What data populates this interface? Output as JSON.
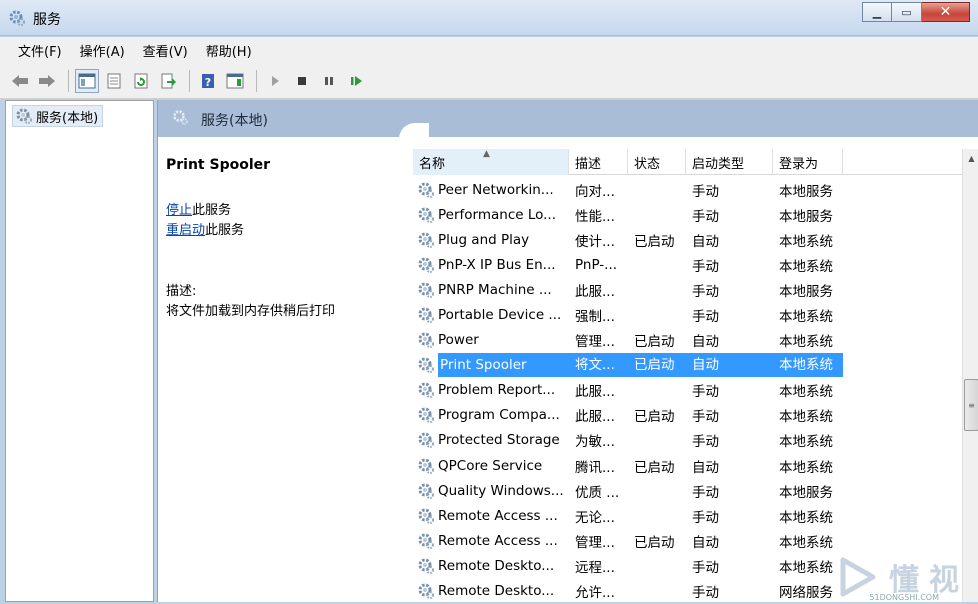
{
  "window": {
    "title": "服务"
  },
  "menu": [
    "文件(F)",
    "操作(A)",
    "查看(V)",
    "帮助(H)"
  ],
  "tree": {
    "root_label": "服务(本地)"
  },
  "main": {
    "header_title": "服务(本地)",
    "selected_service": "Print Spooler",
    "action_stop_link": "停止",
    "action_stop_suffix": "此服务",
    "action_restart_link": "重启动",
    "action_restart_suffix": "此服务",
    "desc_label": "描述:",
    "desc_text": "将文件加载到内存供稍后打印"
  },
  "columns": [
    "名称",
    "描述",
    "状态",
    "启动类型",
    "登录为"
  ],
  "services": [
    {
      "name": "Peer Networkin...",
      "desc": "向对...",
      "status": "",
      "startup": "手动",
      "logon": "本地服务"
    },
    {
      "name": "Performance Lo...",
      "desc": "性能...",
      "status": "",
      "startup": "手动",
      "logon": "本地服务"
    },
    {
      "name": "Plug and Play",
      "desc": "使计...",
      "status": "已启动",
      "startup": "自动",
      "logon": "本地系统"
    },
    {
      "name": "PnP-X IP Bus En...",
      "desc": "PnP-...",
      "status": "",
      "startup": "手动",
      "logon": "本地系统"
    },
    {
      "name": "PNRP Machine ...",
      "desc": "此服...",
      "status": "",
      "startup": "手动",
      "logon": "本地服务"
    },
    {
      "name": "Portable Device ...",
      "desc": "强制...",
      "status": "",
      "startup": "手动",
      "logon": "本地系统"
    },
    {
      "name": "Power",
      "desc": "管理...",
      "status": "已启动",
      "startup": "自动",
      "logon": "本地系统"
    },
    {
      "name": "Print Spooler",
      "desc": "将文...",
      "status": "已启动",
      "startup": "自动",
      "logon": "本地系统"
    },
    {
      "name": "Problem Report...",
      "desc": "此服...",
      "status": "",
      "startup": "手动",
      "logon": "本地系统"
    },
    {
      "name": "Program Compa...",
      "desc": "此服...",
      "status": "已启动",
      "startup": "手动",
      "logon": "本地系统"
    },
    {
      "name": "Protected Storage",
      "desc": "为敏...",
      "status": "",
      "startup": "手动",
      "logon": "本地系统"
    },
    {
      "name": "QPCore Service",
      "desc": "腾讯...",
      "status": "已启动",
      "startup": "自动",
      "logon": "本地系统"
    },
    {
      "name": "Quality Windows...",
      "desc": "优质 ...",
      "status": "",
      "startup": "手动",
      "logon": "本地服务"
    },
    {
      "name": "Remote Access ...",
      "desc": "无论...",
      "status": "",
      "startup": "手动",
      "logon": "本地系统"
    },
    {
      "name": "Remote Access ...",
      "desc": "管理...",
      "status": "已启动",
      "startup": "自动",
      "logon": "本地系统"
    },
    {
      "name": "Remote Deskto...",
      "desc": "远程...",
      "status": "",
      "startup": "手动",
      "logon": "本地系统"
    },
    {
      "name": "Remote Deskto...",
      "desc": "允许...",
      "status": "",
      "startup": "手动",
      "logon": "网络服务"
    }
  ],
  "selected_index": 7,
  "watermark": {
    "text": "懂视",
    "sub": "51DONGSHI.COM"
  },
  "colors": {
    "selection": "#3399ff",
    "header_band": "#a9bed6",
    "link": "#0645ad"
  }
}
